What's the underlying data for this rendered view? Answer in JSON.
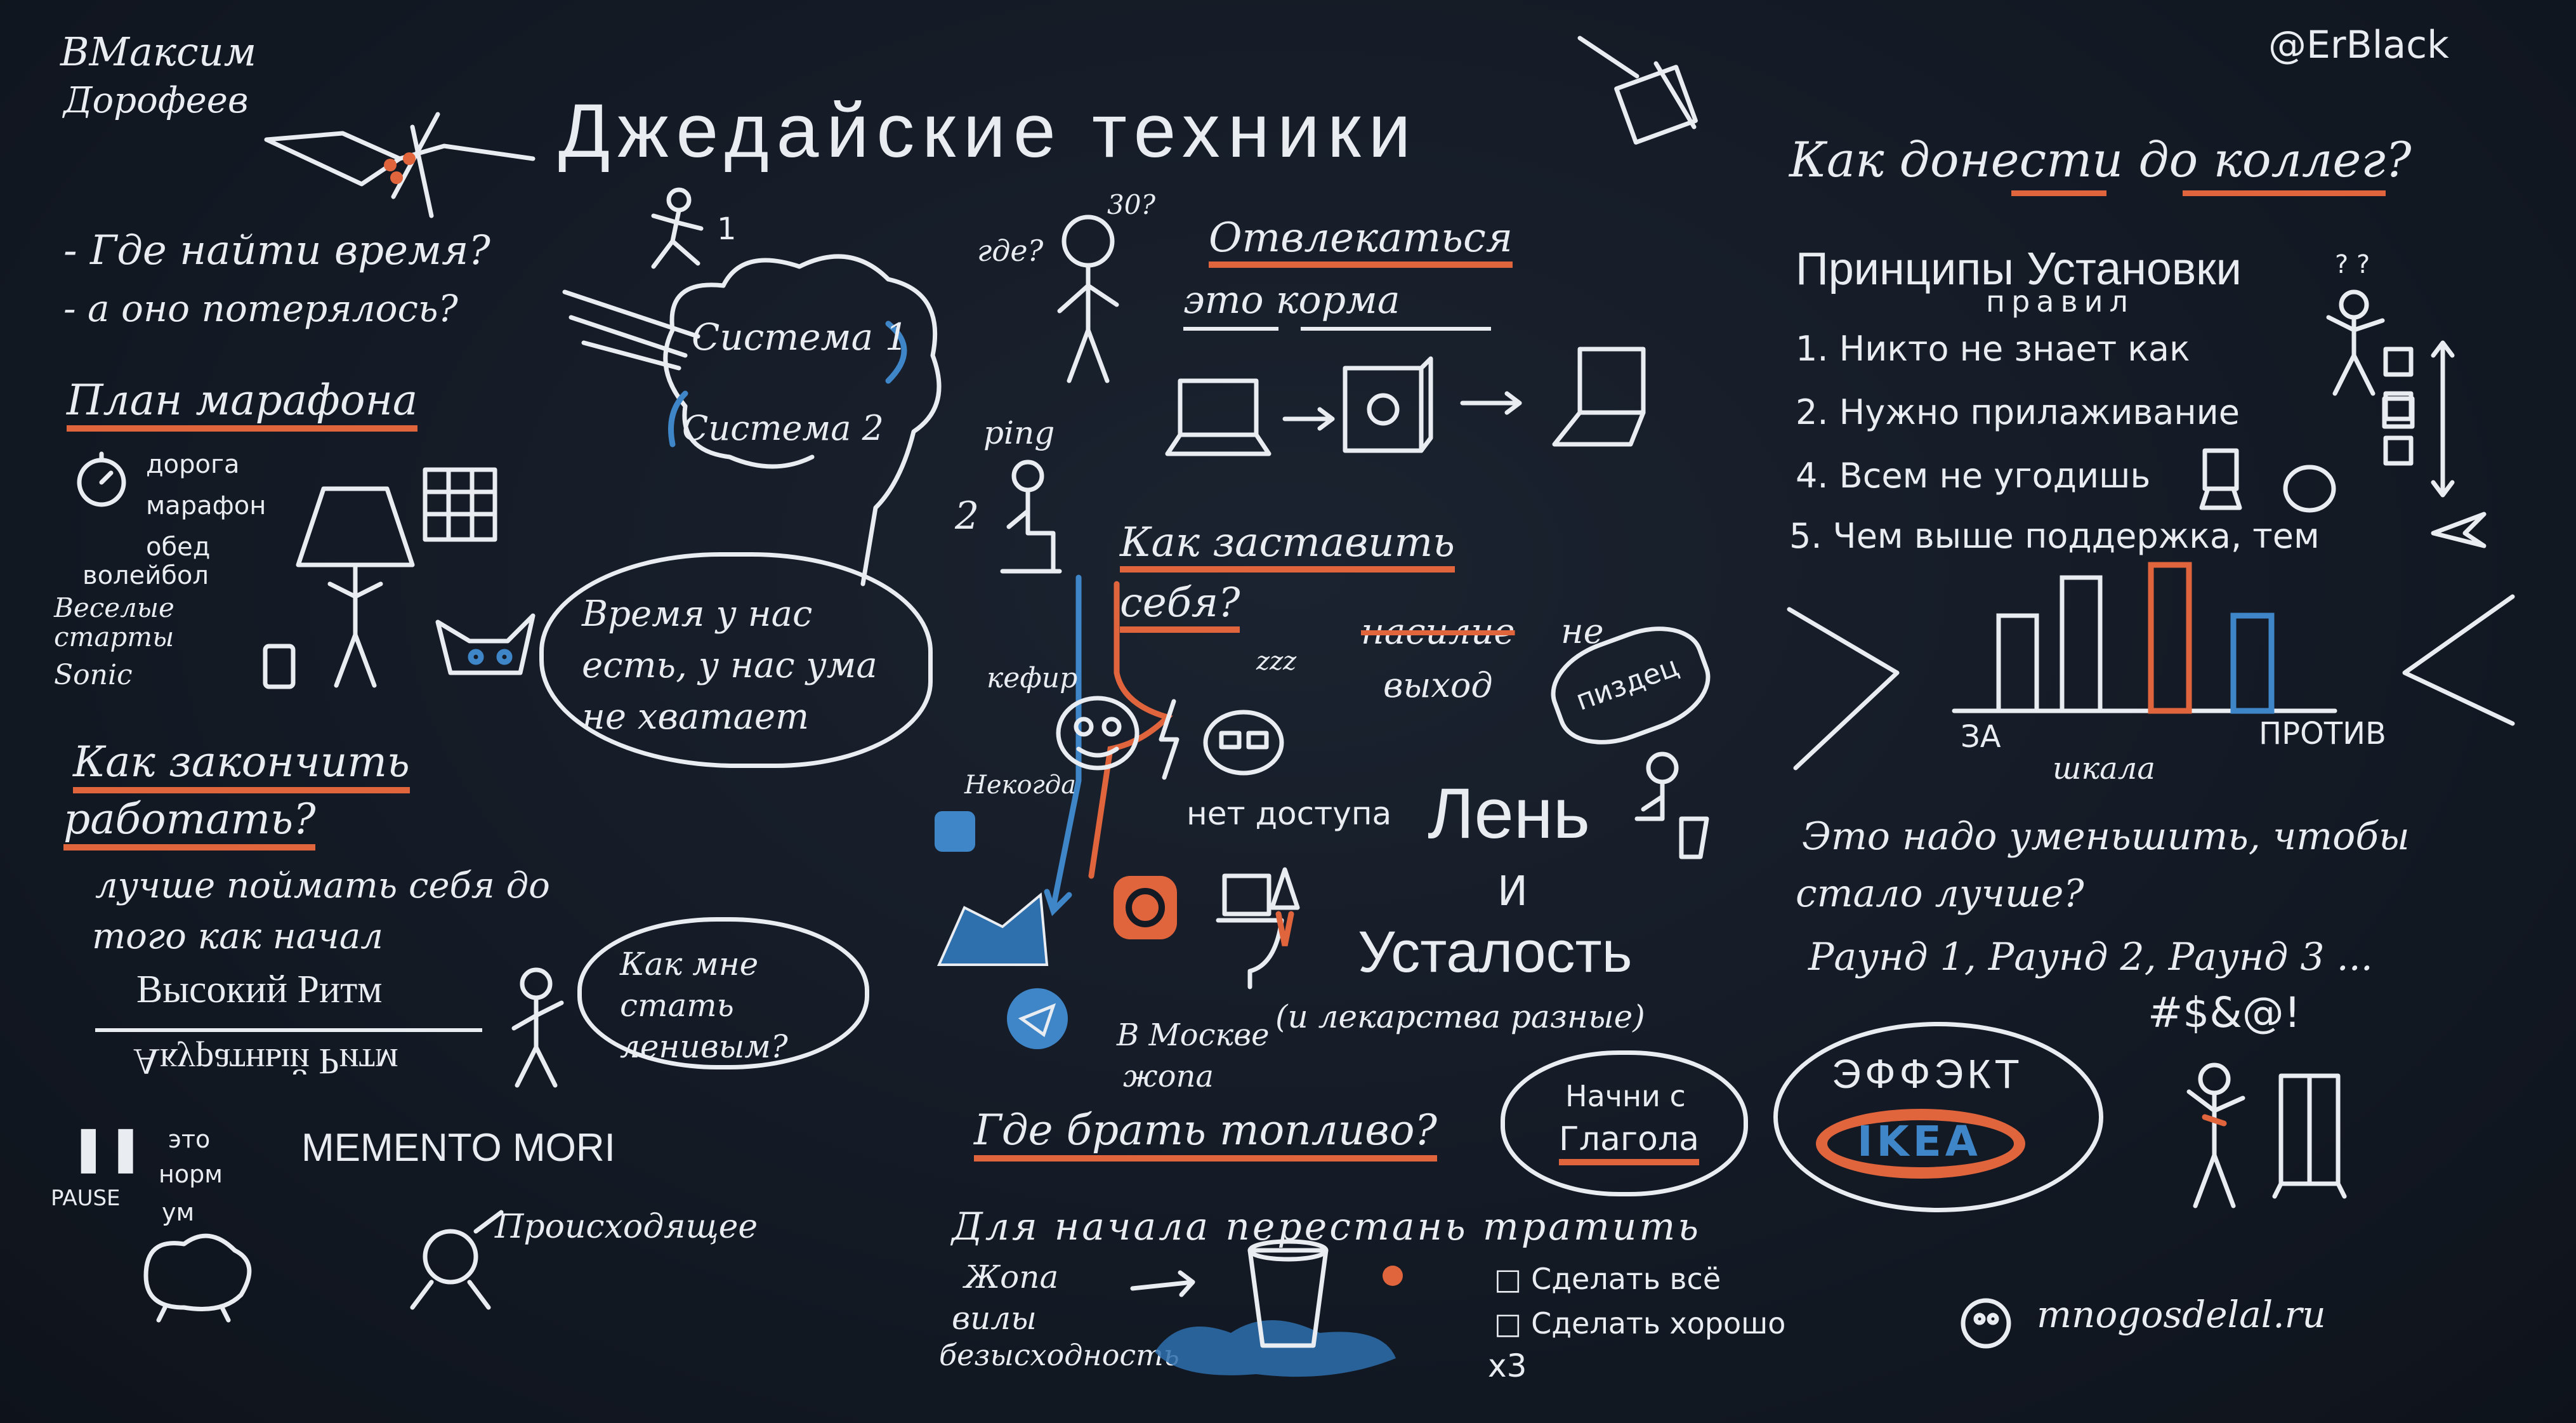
{
  "author": {
    "line1": "ВМаксим",
    "line2": "Дорофеев"
  },
  "handle": "@ErBlack",
  "title": "Джедайские техники",
  "left": {
    "q1": "- Где найти время?",
    "q2": "- а оно потерялось?",
    "marathon_title": "План марафона",
    "marathon_items": [
      "дорога",
      "марафон",
      "обед",
      "волейбол",
      "Веселые старты",
      "Sonic"
    ],
    "bubble_time": "Время у нас есть, у нас ума не хватает",
    "finish_title_1": "Как закончить",
    "finish_title_2": "работать?",
    "finish_text_1": "лучше поймать себя до",
    "finish_text_2": "того как начал",
    "rhythm": "Высокий Ритм",
    "rhythm_mirror": "Акуратный Ритм",
    "bubble_lazy": "Как мне стать ленивым?",
    "pause": "PAUSE",
    "norm_1": "это",
    "norm_2": "норм",
    "norm_3": "ум",
    "memento": "MEMENTO MORI",
    "happening": "Происходящее"
  },
  "middle": {
    "system_1": "Система 1",
    "system_2": "Система 2",
    "num_1": "1",
    "num_2": "2",
    "where": "где?",
    "thirty": "30?",
    "distract_1": "Отвлекаться",
    "distract_2": "это корма",
    "ping": "ping",
    "force_1": "Как заставить",
    "force_2": "себя?",
    "violence": "насилие",
    "not_exit_1": "не",
    "not_exit_2": "выход",
    "kefir": "кефир",
    "nekogda": "Некогда",
    "no_access": "нет доступа",
    "pizdets": "пиздец",
    "lazy": "Лень",
    "and": "И",
    "fatigue": "Усталость",
    "medicines": "(и лекарства разные)",
    "moscow_1": "В Москве",
    "moscow_2": "жопа",
    "fuel": "Где брать топливо?",
    "verb_1": "Начни с",
    "verb_2": "Глагола",
    "stop_wasting": "Для начала перестань тратить",
    "waste_items": [
      "Жопа",
      "вилы",
      "безысходность"
    ],
    "check_1": "Сделать всё",
    "check_2": "Сделать хорошо",
    "times_three": "x3"
  },
  "right": {
    "convey_title": "Как донести до коллег?",
    "principles_title": "Принципы Установки",
    "principles_sub": "правил",
    "principles": [
      "1. Никто не знает как",
      "2. Нужно прилаживание",
      "4. Всем не угодишь",
      "5. Чем выше поддержка, тем"
    ],
    "scale_for": "ЗА",
    "scale_against": "ПРОТИВ",
    "scale_label": "шкала",
    "reduce_1": "Это надо уменьшить, чтобы",
    "reduce_2": "стало лучше?",
    "rounds": "Раунд 1, Раунд 2, Раунд 3 ...",
    "swear": "#$&@!",
    "effect": "ЭФФЭКТ",
    "ikea": "IKEA",
    "site": "mnogosdelal.ru"
  },
  "colors": {
    "chalk": "#e9edf2",
    "accent_orange": "#e0643c",
    "accent_blue": "#3f86c9",
    "board": "#141a24"
  }
}
